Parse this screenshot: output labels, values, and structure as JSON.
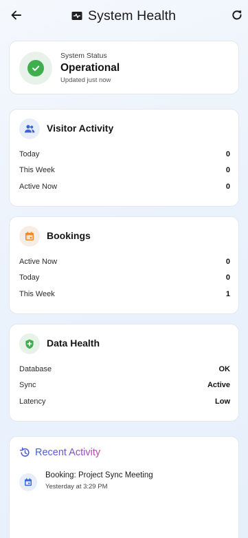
{
  "header": {
    "title": "System Health",
    "icons": {
      "back": "arrow-left-icon",
      "title": "server-icon",
      "refresh": "refresh-icon"
    }
  },
  "status": {
    "label": "System Status",
    "value": "Operational",
    "updated": "Updated just now",
    "icon": "check-circle-icon",
    "color": "#3fae4c"
  },
  "visitor_activity": {
    "title": "Visitor Activity",
    "icon": "people-icon",
    "rows": [
      {
        "label": "Today",
        "value": "0"
      },
      {
        "label": "This Week",
        "value": "0"
      },
      {
        "label": "Active Now",
        "value": "0"
      }
    ]
  },
  "bookings": {
    "title": "Bookings",
    "icon": "calendar-icon",
    "rows": [
      {
        "label": "Active Now",
        "value": "0"
      },
      {
        "label": "Today",
        "value": "0"
      },
      {
        "label": "This Week",
        "value": "1"
      }
    ]
  },
  "data_health": {
    "title": "Data Health",
    "icon": "shield-icon",
    "rows": [
      {
        "label": "Database",
        "value": "OK"
      },
      {
        "label": "Sync",
        "value": "Active"
      },
      {
        "label": "Latency",
        "value": "Low"
      }
    ]
  },
  "recent_activity": {
    "title": "Recent Activity",
    "icon": "history-icon",
    "items": [
      {
        "text": "Booking: Project Sync Meeting",
        "time": "Yesterday at 3:29 PM",
        "icon": "calendar-icon"
      }
    ]
  },
  "colors": {
    "accent_blue": "#3b63d6",
    "accent_orange": "#f0892a",
    "accent_green": "#3fae4c",
    "gradient_start": "#3f5fd0",
    "gradient_end": "#c247a8"
  }
}
